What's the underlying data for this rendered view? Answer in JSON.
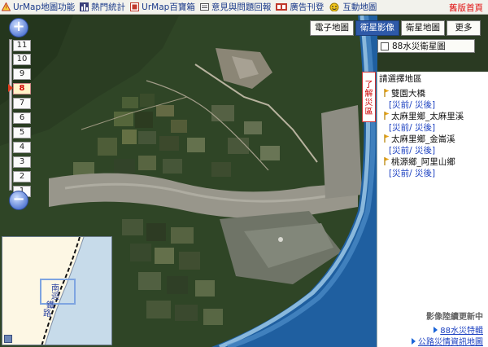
{
  "toolbar": {
    "items": [
      {
        "label": "UrMap地圖功能",
        "icon": "warning-icon"
      },
      {
        "label": "熱門統計",
        "icon": "bar-chart-icon"
      },
      {
        "label": "UrMap百寶箱",
        "icon": "toolbox-icon"
      },
      {
        "label": "意見與問題回報",
        "icon": "feedback-icon"
      },
      {
        "label": "廣告刊登",
        "icon": "ad-icon"
      },
      {
        "label": "互動地圖",
        "icon": "interactive-icon"
      }
    ],
    "home_link": "舊版首頁"
  },
  "zoom": {
    "levels": [
      "11",
      "10",
      "9",
      "8",
      "7",
      "6",
      "5",
      "4",
      "3",
      "2",
      "1"
    ],
    "current_level": "8",
    "plus_icon": "zoom-in-icon",
    "minus_icon": "zoom-out-icon"
  },
  "map_type": {
    "buttons": [
      "電子地圖",
      "衛星影像",
      "衛星地圖",
      "更多"
    ],
    "active": "衛星影像",
    "flood_layer_label": "88水災衛星圖",
    "flood_layer_checked": false
  },
  "overview": {
    "labels": [
      "南",
      "迴",
      "鐵",
      "路"
    ]
  },
  "panel": {
    "side_tab": "了解災區",
    "title": "請選擇地區",
    "areas": [
      {
        "name": "雙園大橋",
        "before": "災前",
        "after": "災後"
      },
      {
        "name": "太麻里鄉_太麻里溪",
        "before": "災前",
        "after": "災後"
      },
      {
        "name": "太麻里鄉_金崙溪",
        "before": "災前",
        "after": "災後"
      },
      {
        "name": "桃源鄉_阿里山鄉",
        "before": "災前",
        "after": "災後"
      }
    ],
    "update_notice": "影像陸續更新中",
    "links": [
      "88水災特輯",
      "公路災情資訊地圖"
    ]
  },
  "colors": {
    "accent": "#2e59a8",
    "link": "#1a3fc0",
    "alert": "#e01010",
    "sea": "#1f5fa0",
    "vegetation": "#2f4a24"
  }
}
